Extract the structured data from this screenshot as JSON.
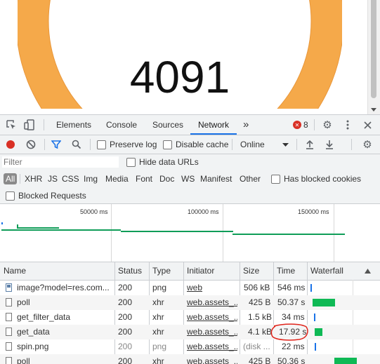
{
  "page": {
    "counter": "4091",
    "gauge_color": "#f5a94a"
  },
  "devtools": {
    "tabs": [
      "Elements",
      "Console",
      "Sources",
      "Network"
    ],
    "active_tab": "Network",
    "more_tabs": "»",
    "error_count": "8",
    "toolbar": {
      "preserve_log": "Preserve log",
      "disable_cache": "Disable cache",
      "throttle": "Online"
    },
    "filter": {
      "placeholder": "Filter",
      "hide_data_urls": "Hide data URLs",
      "types": [
        "All",
        "XHR",
        "JS",
        "CSS",
        "Img",
        "Media",
        "Font",
        "Doc",
        "WS",
        "Manifest",
        "Other"
      ],
      "has_blocked_cookies": "Has blocked cookies",
      "blocked_requests": "Blocked Requests"
    },
    "overview": {
      "ticks": [
        "50000 ms",
        "100000 ms",
        "150000 ms"
      ]
    },
    "table": {
      "headers": [
        "Name",
        "Status",
        "Type",
        "Initiator",
        "Size",
        "Time",
        "Waterfall"
      ],
      "rows": [
        {
          "name": "image?model=res.com...",
          "status": "200",
          "type": "png",
          "initiator": "web",
          "size": "506 kB",
          "time": "546 ms"
        },
        {
          "name": "poll",
          "status": "200",
          "type": "xhr",
          "initiator": "web.assets_...",
          "size": "425 B",
          "time": "50.37 s"
        },
        {
          "name": "get_filter_data",
          "status": "200",
          "type": "xhr",
          "initiator": "web.assets_...",
          "size": "1.5 kB",
          "time": "34 ms"
        },
        {
          "name": "get_data",
          "status": "200",
          "type": "xhr",
          "initiator": "web.assets_...",
          "size": "4.1 kB",
          "time": "17.92 s"
        },
        {
          "name": "spin.png",
          "status": "200",
          "type": "png",
          "initiator": "web.assets_...",
          "size": "(disk ...",
          "time": "22 ms"
        },
        {
          "name": "poll",
          "status": "200",
          "type": "xhr",
          "initiator": "web.assets_...",
          "size": "425 B",
          "time": "50.36 s"
        }
      ]
    }
  }
}
